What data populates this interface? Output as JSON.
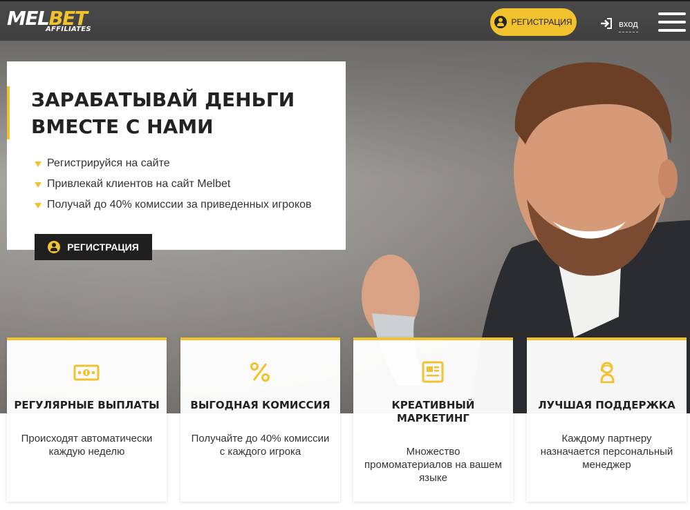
{
  "header": {
    "logo_main_a": "MEL",
    "logo_main_b": "BET",
    "logo_sub": "AFFILIATES",
    "register_label": "РЕГИСТРАЦИЯ",
    "login_label": "вход",
    "menu_icon": "hamburger-menu-icon"
  },
  "hero": {
    "title": "ЗАРАБАТЫВАЙ ДЕНЬГИ ВМЕСТЕ С НАМИ",
    "steps": [
      "Регистрируйся на сайте",
      "Привлекай клиентов на сайт Melbet",
      "Получай до 40% комиссии за приведенных игроков"
    ],
    "register_label": "РЕГИСТРАЦИЯ"
  },
  "features": [
    {
      "icon": "banknote-icon",
      "title": "РЕГУЛЯРНЫЕ ВЫПЛАТЫ",
      "desc": "Происходят автоматически каждую неделю"
    },
    {
      "icon": "percent-icon",
      "title": "ВЫГОДНАЯ КОМИССИЯ",
      "desc": "Получайте до 40% комиссии с каждого игрока"
    },
    {
      "icon": "newspaper-icon",
      "title": "КРЕАТИВНЫЙ МАРКЕТИНГ",
      "desc": "Множество промоматериалов на вашем языке"
    },
    {
      "icon": "support-operator-icon",
      "title": "ЛУЧШАЯ ПОДДЕРЖКА",
      "desc": "Каждому партнеру назначается персональный менеджер"
    }
  ],
  "colors": {
    "accent": "#f2c12e",
    "header_bg": "#444444",
    "dark_button": "#1f1f1f"
  }
}
